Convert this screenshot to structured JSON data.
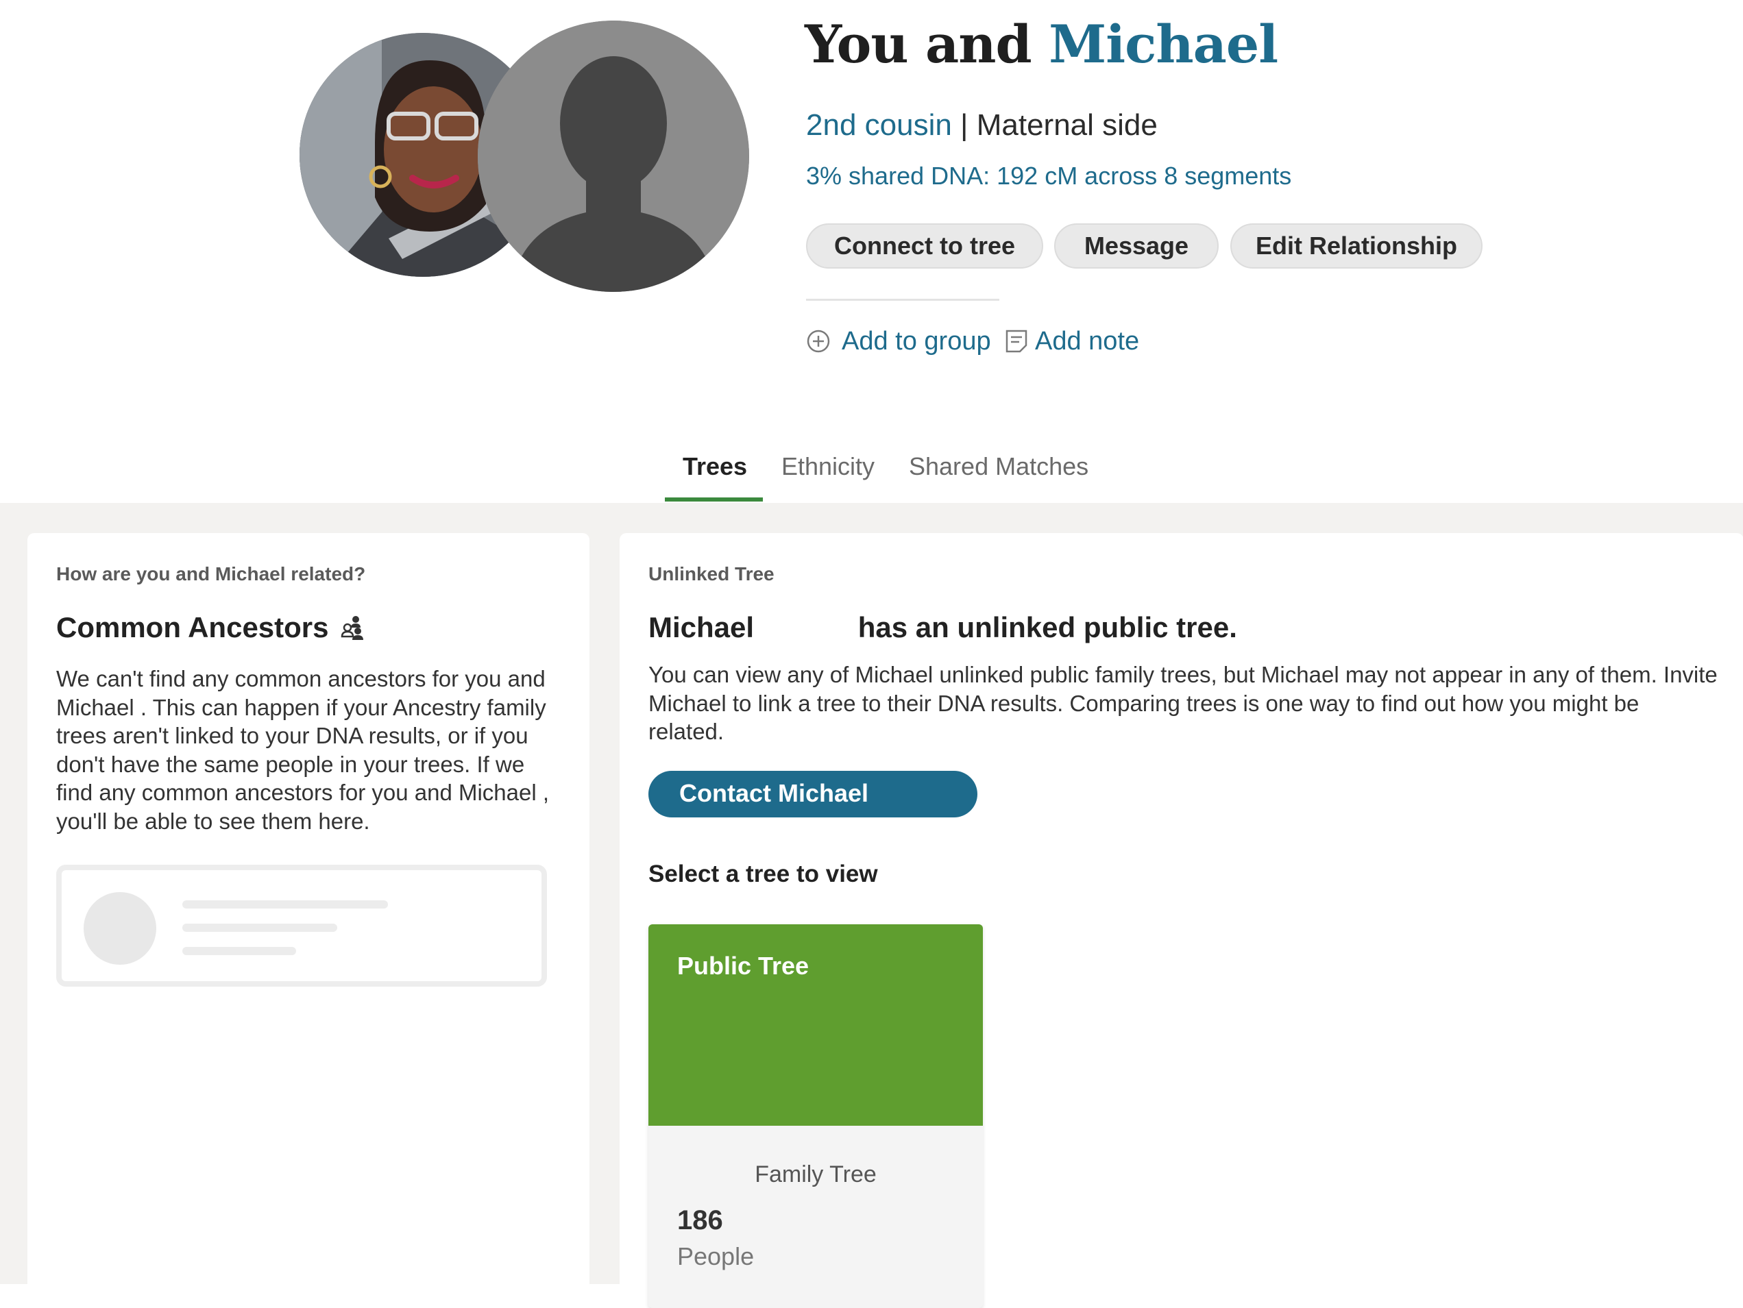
{
  "header": {
    "title_prefix": "You and ",
    "title_name": "Michael",
    "relationship": "2nd cousin",
    "separator": " | ",
    "side": "Maternal side",
    "dna_summary": "3% shared DNA: 192 cM across 8 segments"
  },
  "actions": {
    "connect": "Connect to tree",
    "message": "Message",
    "edit": "Edit Relationship",
    "add_group": "Add to group",
    "add_note": "Add note"
  },
  "tabs": [
    "Trees",
    "Ethnicity",
    "Shared Matches"
  ],
  "left_card": {
    "eyebrow": "How are you and Michael          related?",
    "heading": "Common Ancestors",
    "body": "We can't find any common ancestors for you and Michael          . This can happen if your Ancestry family trees aren't linked to your DNA results, or if you don't have the same people in your trees.  If we find any common ancestors for you and Michael          , you'll be able to see them here."
  },
  "right_card": {
    "eyebrow": "Unlinked Tree",
    "heading": "Michael             has an unlinked public tree.",
    "body": "You can view any of Michael             unlinked public family trees, but Michael             may not appear in any of them. Invite Michael             to link a tree to their DNA results. Comparing trees is one way to find out how you might be related.",
    "contact_button": "Contact Michael",
    "select_label": "Select a tree to view",
    "tree_card": {
      "title": "Public Tree",
      "type": "Family Tree",
      "count": "186",
      "count_label": "People"
    }
  },
  "colors": {
    "link_blue": "#1e6b8c",
    "tab_active_green": "#3b8a3d",
    "tree_banner_green": "#5f9e2f"
  },
  "icons": [
    "add-circle-icon",
    "note-icon",
    "people-icon",
    "person-silhouette-icon"
  ]
}
